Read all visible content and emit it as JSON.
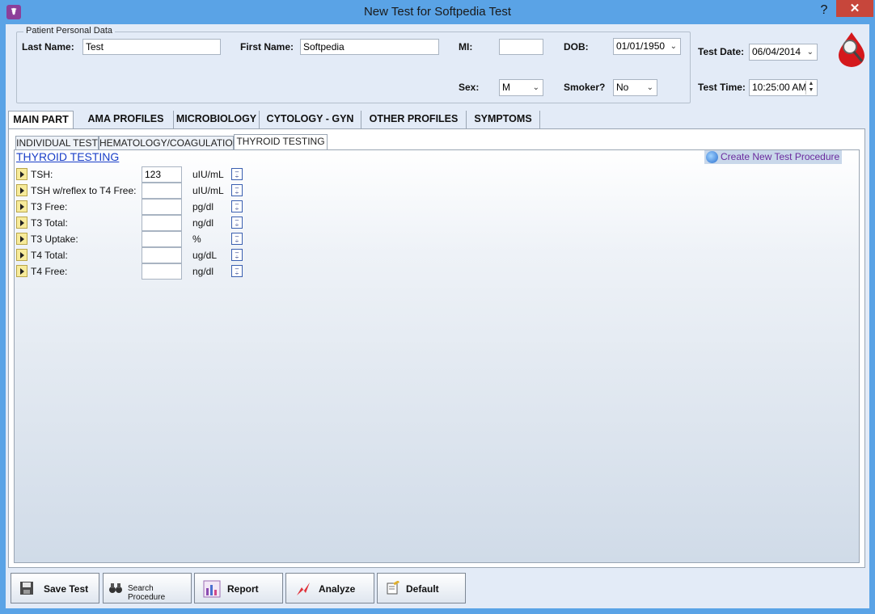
{
  "window": {
    "title": "New Test for Softpedia Test",
    "help_label": "?",
    "close_label": "✕",
    "app_icon_glyph": "☤"
  },
  "patient": {
    "group_title": "Patient Personal Data",
    "last_name_label": "Last Name:",
    "last_name_value": "Test",
    "first_name_label": "First Name:",
    "first_name_value": "Softpedia",
    "mi_label": "MI:",
    "mi_value": "",
    "dob_label": "DOB:",
    "dob_value": "01/01/1950",
    "sex_label": "Sex:",
    "sex_value": "M",
    "smoker_label": "Smoker?",
    "smoker_value": "No",
    "test_date_label": "Test Date:",
    "test_date_value": "06/04/2014",
    "test_time_label": "Test Time:",
    "test_time_value": "10:25:00 AM"
  },
  "main_tabs": [
    {
      "label": "MAIN PART",
      "active": true
    },
    {
      "label": "AMA PROFILES"
    },
    {
      "label": "MICROBIOLOGY"
    },
    {
      "label": "CYTOLOGY - GYN"
    },
    {
      "label": "OTHER PROFILES"
    },
    {
      "label": "SYMPTOMS"
    }
  ],
  "sub_tabs": [
    {
      "label": "INDIVIDUAL TEST"
    },
    {
      "label": "HEMATOLOGY/COAGULATION"
    },
    {
      "label": "THYROID TESTING",
      "active": true
    }
  ],
  "thyroid": {
    "section_title": "THYROID TESTING",
    "create_link": "Create New Test Procedure",
    "tests": [
      {
        "name": "TSH:",
        "value": "123",
        "unit": "uIU/mL"
      },
      {
        "name": "TSH w/reflex to T4 Free:",
        "value": "",
        "unit": "uIU/mL"
      },
      {
        "name": "T3 Free:",
        "value": "",
        "unit": "pg/dl"
      },
      {
        "name": "T3 Total:",
        "value": "",
        "unit": "ng/dl"
      },
      {
        "name": "T3 Uptake:",
        "value": "",
        "unit": "%"
      },
      {
        "name": "T4 Total:",
        "value": "",
        "unit": "ug/dL"
      },
      {
        "name": "T4 Free:",
        "value": "",
        "unit": "ng/dl"
      }
    ]
  },
  "buttons": {
    "save": "Save Test",
    "search": "Search Procedure",
    "report": "Report",
    "analyze": "Analyze",
    "default": "Default"
  },
  "colors": {
    "title_bar": "#5aa3e6",
    "close": "#c7463b",
    "link_purple": "#6b2a9e",
    "section_blue": "#1a3fc8"
  }
}
